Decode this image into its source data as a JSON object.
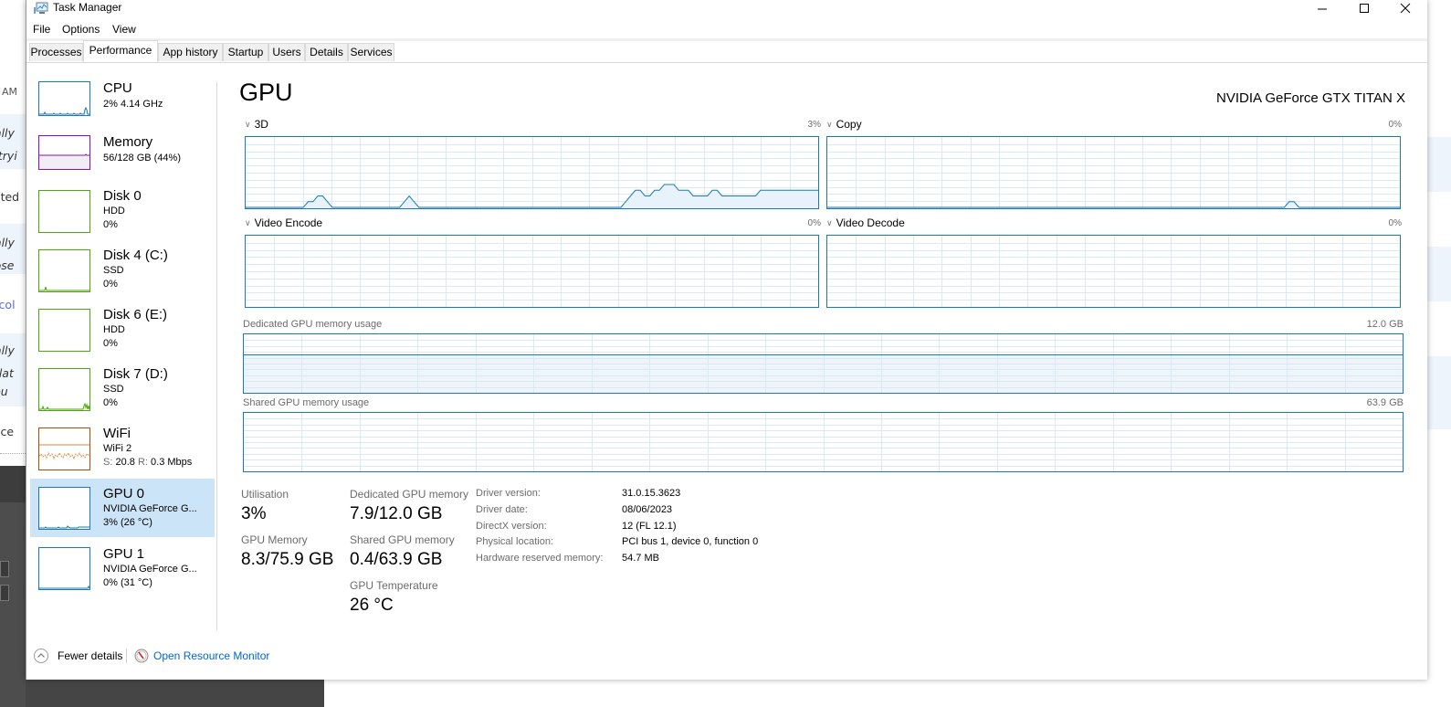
{
  "background": {
    "left_fragments": [
      "AM",
      "nally",
      "n tryi",
      "ected",
      "nally",
      "oose",
      "B col",
      "nally",
      "relat",
      "cpu",
      "acce"
    ]
  },
  "window": {
    "title": "Task Manager",
    "controls": {
      "minimize": "minimize",
      "maximize": "maximize",
      "close": "close"
    }
  },
  "menu": [
    "File",
    "Options",
    "View"
  ],
  "tabs": [
    {
      "label": "Processes",
      "active": false
    },
    {
      "label": "Performance",
      "active": true
    },
    {
      "label": "App history",
      "active": false
    },
    {
      "label": "Startup",
      "active": false
    },
    {
      "label": "Users",
      "active": false
    },
    {
      "label": "Details",
      "active": false
    },
    {
      "label": "Services",
      "active": false
    }
  ],
  "sidebar": {
    "items": [
      {
        "name": "CPU",
        "line1": "2% 4.14 GHz",
        "line2": "",
        "color": "#1b79b5"
      },
      {
        "name": "Memory",
        "line1": "56/128 GB (44%)",
        "line2": "",
        "color": "#8b12ae",
        "fill_fraction": 0.44
      },
      {
        "name": "Disk 0",
        "line1": "HDD",
        "line2": "0%",
        "color": "#4da60c"
      },
      {
        "name": "Disk 4 (C:)",
        "line1": "SSD",
        "line2": "0%",
        "color": "#4da60c"
      },
      {
        "name": "Disk 6 (E:)",
        "line1": "HDD",
        "line2": "0%",
        "color": "#4da60c"
      },
      {
        "name": "Disk 7 (D:)",
        "line1": "SSD",
        "line2": "0%",
        "color": "#4da60c"
      },
      {
        "name": "WiFi",
        "line1": "WiFi 2",
        "line2_send_label": "S:",
        "line2_send": "20.8",
        "line2_recv_label": "R:",
        "line2_recv": "0.3 Mbps",
        "color": "#a74f01"
      },
      {
        "name": "GPU 0",
        "line1": "NVIDIA GeForce G...",
        "line2": "3%  (26 °C)",
        "color": "#1b79b5",
        "selected": true
      },
      {
        "name": "GPU 1",
        "line1": "NVIDIA GeForce G...",
        "line2": "0%  (31 °C)",
        "color": "#1b79b5"
      }
    ]
  },
  "main": {
    "title": "GPU",
    "device_name": "NVIDIA GeForce GTX TITAN X",
    "engines": [
      {
        "label": "3D",
        "value": "3%"
      },
      {
        "label": "Copy",
        "value": "0%"
      },
      {
        "label": "Video Encode",
        "value": "0%"
      },
      {
        "label": "Video Decode",
        "value": "0%"
      }
    ],
    "dedicated_memory": {
      "label": "Dedicated GPU memory usage",
      "max": "12.0 GB",
      "used_fraction": 0.66
    },
    "shared_memory": {
      "label": "Shared GPU memory usage",
      "max": "63.9 GB",
      "used_fraction": 0.006
    },
    "stats": {
      "utilisation_label": "Utilisation",
      "utilisation": "3%",
      "gpu_memory_label": "GPU Memory",
      "gpu_memory": "8.3/75.9 GB",
      "dedicated_label": "Dedicated GPU memory",
      "dedicated": "7.9/12.0 GB",
      "shared_label": "Shared GPU memory",
      "shared": "0.4/63.9 GB",
      "temp_label": "GPU Temperature",
      "temp": "26 °C"
    },
    "info": [
      {
        "label": "Driver version:",
        "value": "31.0.15.3623"
      },
      {
        "label": "Driver date:",
        "value": "08/06/2023"
      },
      {
        "label": "DirectX version:",
        "value": "12 (FL 12.1)"
      },
      {
        "label": "Physical location:",
        "value": "PCI bus 1, device 0, function 0"
      },
      {
        "label": "Hardware reserved memory:",
        "value": "54.7 MB"
      }
    ]
  },
  "footer": {
    "fewer_details": "Fewer details",
    "open_resource_monitor": "Open Resource Monitor"
  },
  "colors": {
    "gpu_accent": "#1b79b5",
    "grid": "#d9eaf4",
    "selected_bg": "#cce4f7",
    "link": "#0066cc"
  },
  "chart_data": [
    {
      "type": "line",
      "title": "3D",
      "ylim": [
        0,
        100
      ],
      "current": 3,
      "values": [
        0,
        0,
        0,
        0,
        0,
        0,
        0,
        0,
        0,
        0,
        0,
        0,
        0,
        1,
        1,
        2,
        2,
        1,
        0,
        0,
        0,
        0,
        0,
        0,
        0,
        0,
        0,
        0,
        0,
        0,
        0,
        0,
        0,
        1,
        2,
        1,
        0,
        0,
        0,
        0,
        0,
        0,
        0,
        0,
        0,
        0,
        0,
        0,
        0,
        0,
        0,
        0,
        0,
        0,
        0,
        0,
        0,
        0,
        0,
        0,
        0,
        0,
        0,
        0,
        0,
        0,
        0,
        0,
        0,
        0,
        0,
        0,
        0,
        0,
        0,
        0,
        0,
        0,
        0,
        1,
        2,
        3,
        3,
        2,
        2,
        3,
        3,
        4,
        4,
        4,
        3,
        3,
        3,
        2,
        2,
        2,
        2,
        3,
        3,
        2,
        2,
        2,
        2,
        2,
        2,
        2,
        2,
        3,
        3,
        3,
        3,
        3,
        3,
        3,
        3,
        3,
        3,
        3,
        3,
        3
      ]
    },
    {
      "type": "line",
      "title": "Copy",
      "ylim": [
        0,
        100
      ],
      "current": 0,
      "values": [
        0,
        0,
        0,
        0,
        0,
        0,
        0,
        0,
        0,
        0,
        0,
        0,
        0,
        0,
        0,
        0,
        0,
        0,
        0,
        0,
        0,
        0,
        0,
        0,
        0,
        0,
        0,
        0,
        0,
        0,
        0,
        0,
        0,
        0,
        0,
        0,
        0,
        0,
        0,
        0,
        0,
        0,
        0,
        0,
        0,
        0,
        0,
        0,
        0,
        0,
        0,
        0,
        0,
        0,
        0,
        0,
        0,
        0,
        0,
        0,
        0,
        0,
        0,
        0,
        0,
        0,
        0,
        0,
        0,
        0,
        0,
        0,
        0,
        0,
        0,
        0,
        0,
        0,
        0,
        0,
        0,
        0,
        0,
        0,
        0,
        0,
        0,
        0,
        0,
        0,
        0,
        0,
        0,
        0,
        0,
        0,
        1,
        1,
        0,
        0,
        0,
        0,
        0,
        0,
        0,
        0,
        0,
        0,
        0,
        0,
        0,
        0,
        0,
        0,
        0,
        0,
        0,
        0,
        0,
        0
      ]
    },
    {
      "type": "line",
      "title": "Video Encode",
      "ylim": [
        0,
        100
      ],
      "current": 0,
      "values": []
    },
    {
      "type": "line",
      "title": "Video Decode",
      "ylim": [
        0,
        100
      ],
      "current": 0,
      "values": []
    },
    {
      "type": "area",
      "title": "Dedicated GPU memory usage",
      "ylim": [
        0,
        12.0
      ],
      "unit": "GB",
      "current": 7.9
    },
    {
      "type": "area",
      "title": "Shared GPU memory usage",
      "ylim": [
        0,
        63.9
      ],
      "unit": "GB",
      "current": 0.4
    }
  ]
}
